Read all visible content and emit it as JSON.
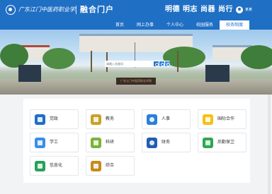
{
  "header": {
    "school_name": "广东江门中医药职业学院",
    "portal_title": "融合门户",
    "motto": "明德 明志 尚器 尚行",
    "user_name": "某某"
  },
  "nav": [
    {
      "label": "首页"
    },
    {
      "label": "网上办事"
    },
    {
      "label": "个人中心"
    },
    {
      "label": "校园服务"
    },
    {
      "label": "校务制度"
    }
  ],
  "search": {
    "placeholder": "请输入关键词"
  },
  "banner": {
    "stamp_text": "广东江门中医药职业学院"
  },
  "apps": [
    {
      "label": "党政",
      "icon": "party-icon",
      "color": "#1f6fc4"
    },
    {
      "label": "教务",
      "icon": "academic-icon",
      "color": "#c9a227"
    },
    {
      "label": "人事",
      "icon": "personnel-icon",
      "color": "#2b7fd8"
    },
    {
      "label": "国际合作",
      "icon": "international-icon",
      "color": "#f2c21a"
    },
    {
      "label": "学工",
      "icon": "student-affairs-icon",
      "color": "#3a8ee6"
    },
    {
      "label": "科研",
      "icon": "research-icon",
      "color": "#7ab33a"
    },
    {
      "label": "财务",
      "icon": "finance-icon",
      "color": "#1f5fb0"
    },
    {
      "label": "后勤保卫",
      "icon": "logistics-icon",
      "color": "#2ea84f"
    },
    {
      "label": "信息化",
      "icon": "informatization-icon",
      "color": "#27a05a"
    },
    {
      "label": "综合",
      "icon": "comprehensive-icon",
      "color": "#c98a1a"
    }
  ]
}
